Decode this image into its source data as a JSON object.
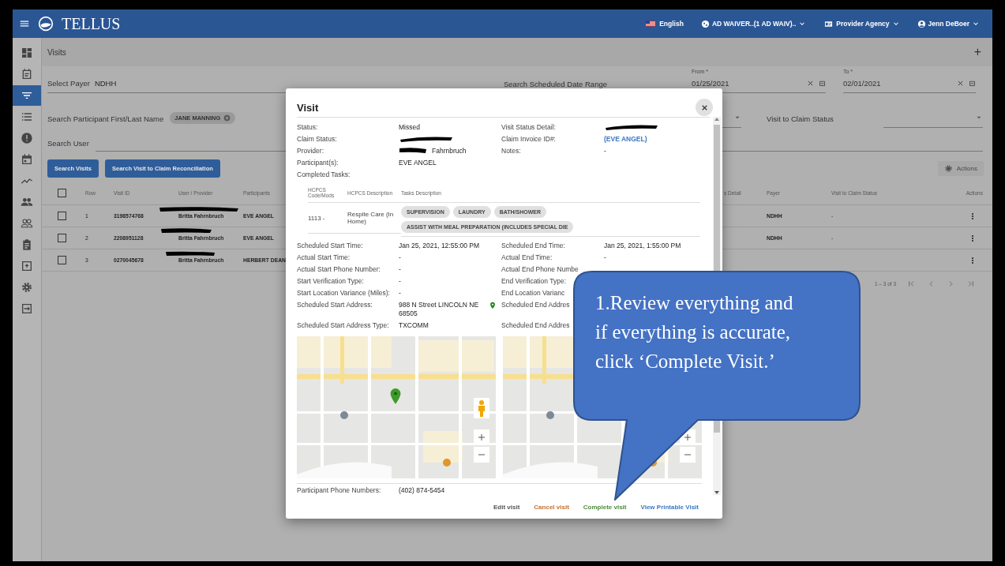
{
  "top_bar": {
    "brand": "TELLUS",
    "language": "English",
    "program": "AD WAIVER..(1 AD WAIV)..",
    "role": "Provider Agency",
    "user": "Jenn DeBoer"
  },
  "sidebar": {
    "items": [
      {
        "kind": "dashboard",
        "selected": false
      },
      {
        "kind": "note",
        "selected": false
      },
      {
        "kind": "filter",
        "selected": true
      },
      {
        "kind": "list",
        "selected": false
      },
      {
        "kind": "alert",
        "selected": false
      },
      {
        "kind": "calendar",
        "selected": false
      },
      {
        "kind": "trend",
        "selected": false
      },
      {
        "kind": "people",
        "selected": false
      },
      {
        "kind": "people_outline",
        "selected": false
      },
      {
        "kind": "clipboard",
        "selected": false
      },
      {
        "kind": "upload",
        "selected": false
      },
      {
        "kind": "gear",
        "selected": false
      },
      {
        "kind": "exit",
        "selected": false
      }
    ]
  },
  "page": {
    "title": "Visits",
    "add": "+"
  },
  "filters": {
    "payer_label": "Select Payer",
    "payer_value": "NDHH",
    "date_range_label": "Search Scheduled Date Range",
    "from_label": "From *",
    "from_value": "01/25/2021",
    "to_label": "To *",
    "to_value": "02/01/2021",
    "participant_label": "Search Participant First/Last Name",
    "participant_chip": "JANE MANNING",
    "claim_status_label": "Visit to Claim Status",
    "user_label": "Search User"
  },
  "buttons": [
    "Search Visits",
    "Search Visit to Claim Reconciliation"
  ],
  "actions_button": {
    "label": "Actions",
    "disabled": true
  },
  "table": {
    "select_all": {
      "checked": false
    },
    "columns": [
      "Row",
      "Visit ID",
      "User / Provider",
      "Participants",
      "s Detail",
      "Payer",
      "Visit to Claim Status",
      "Actions"
    ],
    "rows": [
      {
        "checked": false,
        "row": "1",
        "visit_id": "3198574768",
        "user": "Britta Fahrnbruch",
        "participants": "EVE ANGEL",
        "payer": "NDHH",
        "claim_status": "-"
      },
      {
        "checked": false,
        "row": "2",
        "visit_id": "2208951128",
        "user": "Britta Fahrnbruch",
        "participants": "EVE ANGEL",
        "payer": "NDHH",
        "claim_status": "-"
      },
      {
        "checked": false,
        "row": "3",
        "visit_id": "0270045678",
        "user": "Britta Fahrnbruch",
        "participants": "HERBERT DEAN"
      }
    ]
  },
  "pagination": {
    "range": "1 – 3 of 3"
  },
  "modal": {
    "title": "Visit",
    "summary": [
      {
        "cells": [
          {
            "label": "Status:",
            "value": "Missed",
            "kind": "text"
          },
          {
            "label": "Visit Status Detail:",
            "kind": "redacted"
          }
        ]
      },
      {
        "cells": [
          {
            "label": "Claim Status:",
            "kind": "redacted"
          },
          {
            "label": "Claim Invoice ID#:",
            "value": "(EVE ANGEL)",
            "kind": "link"
          }
        ]
      },
      {
        "cells": [
          {
            "label": "Provider:",
            "value": "Fahrnbruch",
            "kind": "partly_redacted"
          },
          {
            "label": "Notes:",
            "value": "-",
            "kind": "text"
          }
        ]
      },
      {
        "cells": [
          {
            "label": "Participant(s):",
            "value": "EVE ANGEL",
            "kind": "text"
          }
        ]
      },
      {
        "cells": [
          {
            "label": "Completed Tasks:",
            "kind": "text"
          }
        ]
      }
    ],
    "tasks": {
      "columns": [
        "HCPCS Code/Mods",
        "HCPCS Description",
        "Tasks Description"
      ],
      "rows": [
        {
          "code": "1113 -",
          "description": "Respite Care (In Home)",
          "tasks": [
            "SUPERVISION",
            "LAUNDRY",
            "BATH/SHOWER",
            "ASSIST WITH MEAL PREPARATION (INCLUDES SPECIAL DIE"
          ]
        }
      ]
    },
    "schedule": [
      {
        "cells": [
          {
            "label": "Scheduled Start Time:",
            "value": "Jan 25, 2021, 12:55:00 PM",
            "kind": "text"
          },
          {
            "label": "Scheduled End Time:",
            "value": "Jan 25, 2021, 1:55:00 PM",
            "kind": "text"
          }
        ]
      },
      {
        "cells": [
          {
            "label": "Actual Start Time:",
            "value": "-",
            "kind": "text"
          },
          {
            "label": "Actual End Time:",
            "value": "-",
            "kind": "text"
          }
        ]
      },
      {
        "cells": [
          {
            "label": "Actual Start Phone Number:",
            "value": "-",
            "kind": "text"
          },
          {
            "label": "Actual End Phone Numbe",
            "kind": "text"
          }
        ]
      },
      {
        "cells": [
          {
            "label": "Start Verification Type:",
            "value": "-",
            "kind": "text"
          },
          {
            "label": "End Verification Type:",
            "kind": "text"
          }
        ]
      },
      {
        "cells": [
          {
            "label": "Start Location Variance (Miles):",
            "value": "-",
            "kind": "text"
          },
          {
            "label": "End Location Varianc",
            "kind": "text"
          }
        ]
      },
      {
        "cells": [
          {
            "label": "Scheduled Start Address:",
            "value": "988 N Street LINCOLN NE 68505",
            "kind": "address"
          },
          {
            "label": "Scheduled End Addres",
            "kind": "text"
          }
        ]
      },
      {
        "cells": [
          {
            "label": "Scheduled Start Address Type:",
            "value": "TXCOMM",
            "kind": "text"
          },
          {
            "label": "Scheduled End Addres",
            "kind": "text"
          }
        ]
      }
    ],
    "maps": [
      {
        "kind": "picture",
        "pin": true
      },
      {
        "kind": "picture",
        "pin": false
      }
    ],
    "phone": {
      "label": "Participant Phone Numbers:",
      "value": "(402) 874-5454"
    },
    "actions": [
      {
        "label": "Edit visit",
        "color": "#555555"
      },
      {
        "label": "Cancel visit",
        "color": "#c2702c"
      },
      {
        "label": "Complete visit",
        "color": "#4c8a3c"
      },
      {
        "label": "View Printable Visit",
        "color": "#3b78c3"
      }
    ]
  },
  "callout": {
    "text": "1.Review everything and\nif everything is accurate,\nclick  ‘Complete Visit.’"
  }
}
